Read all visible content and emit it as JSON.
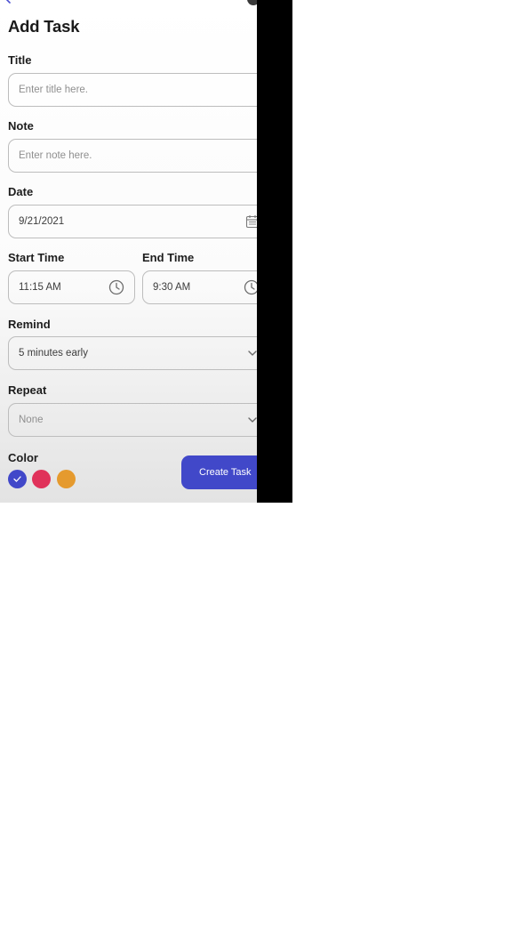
{
  "header": {
    "title": "Add Task"
  },
  "form": {
    "title": {
      "label": "Title",
      "placeholder": "Enter title here."
    },
    "note": {
      "label": "Note",
      "placeholder": "Enter note here."
    },
    "date": {
      "label": "Date",
      "value": "9/21/2021"
    },
    "start_time": {
      "label": "Start Time",
      "value": "11:15 AM"
    },
    "end_time": {
      "label": "End Time",
      "value": "9:30 AM"
    },
    "remind": {
      "label": "Remind",
      "value": "5 minutes early"
    },
    "repeat": {
      "label": "Repeat",
      "value": "None"
    },
    "color": {
      "label": "Color",
      "options": [
        {
          "name": "blue",
          "hex": "#4148c9",
          "selected": true
        },
        {
          "name": "pink",
          "hex": "#e0325a",
          "selected": false
        },
        {
          "name": "orange",
          "hex": "#e59a2e",
          "selected": false
        }
      ]
    }
  },
  "actions": {
    "create_label": "Create Task"
  },
  "theme": {
    "accent": "#4148c9"
  }
}
